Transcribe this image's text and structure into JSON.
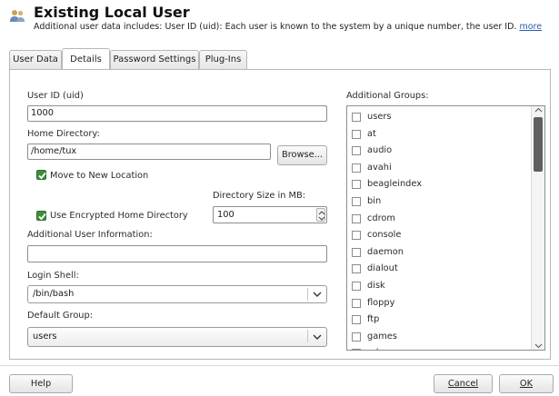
{
  "header": {
    "title": "Existing Local User",
    "subtitle": "Additional user data includes: User ID (uid): Each user is known to the system by a unique number, the user ID.",
    "more_link": "more",
    "icon": "users-icon"
  },
  "tabs": [
    {
      "label": "User Data",
      "active": false
    },
    {
      "label": "Details",
      "active": true
    },
    {
      "label": "Password Settings",
      "active": false
    },
    {
      "label": "Plug-Ins",
      "active": false
    }
  ],
  "details": {
    "uid_label": "User ID (uid)",
    "uid_value": "1000",
    "home_label": "Home Directory:",
    "home_value": "/home/tux",
    "browse_label": "Browse...",
    "move_label": "Move to New Location",
    "move_checked": true,
    "dir_size_label": "Directory Size in MB:",
    "dir_size_value": "100",
    "encrypt_label": "Use Encrypted Home Directory",
    "encrypt_checked": true,
    "additional_info_label": "Additional User Information:",
    "additional_info_value": "",
    "shell_label": "Login Shell:",
    "shell_value": "/bin/bash",
    "default_group_label": "Default Group:",
    "default_group_value": "users"
  },
  "groups": {
    "label": "Additional Groups:",
    "items": [
      "users",
      "at",
      "audio",
      "avahi",
      "beagleindex",
      "bin",
      "cdrom",
      "console",
      "daemon",
      "dialout",
      "disk",
      "floppy",
      "ftp",
      "games",
      "gdm"
    ]
  },
  "footer": {
    "help_label": "Help",
    "cancel_label": "Cancel",
    "ok_label": "OK"
  },
  "colors": {
    "checkbox_checked": "#3d8f3d",
    "link": "#2a5db0"
  }
}
